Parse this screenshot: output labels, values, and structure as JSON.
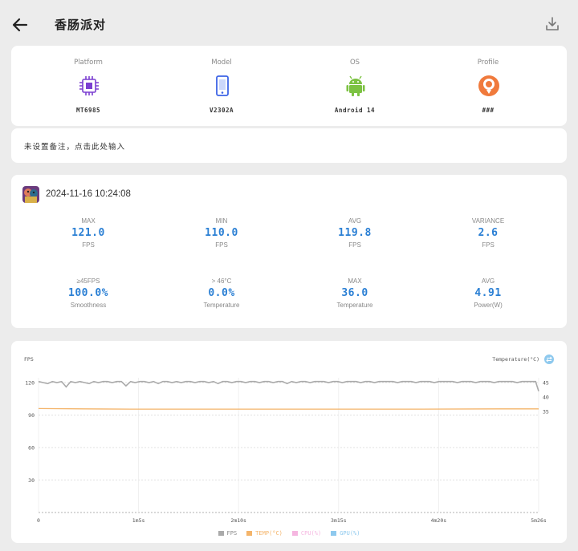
{
  "header": {
    "title": "香肠派对"
  },
  "device": {
    "items": [
      {
        "label": "Platform",
        "value": "MT6985",
        "icon": "chip-icon"
      },
      {
        "label": "Model",
        "value": "V2302A",
        "icon": "phone-icon"
      },
      {
        "label": "OS",
        "value": "Android 14",
        "icon": "android-icon"
      },
      {
        "label": "Profile",
        "value": "###",
        "icon": "profile-icon"
      }
    ]
  },
  "note": {
    "text": "未设置备注，点击此处输入"
  },
  "session": {
    "datetime": "2024-11-16 10:24:08",
    "stats": [
      {
        "label": "MAX",
        "value": "121.0",
        "unit": "FPS"
      },
      {
        "label": "MIN",
        "value": "110.0",
        "unit": "FPS"
      },
      {
        "label": "AVG",
        "value": "119.8",
        "unit": "FPS"
      },
      {
        "label": "VARIANCE",
        "value": "2.6",
        "unit": "FPS"
      },
      {
        "label": "≥45FPS",
        "value": "100.0%",
        "unit": "Smoothness"
      },
      {
        "label": "> 46°C",
        "value": "0.0%",
        "unit": "Temperature"
      },
      {
        "label": "MAX",
        "value": "36.0",
        "unit": "Temperature"
      },
      {
        "label": "AVG",
        "value": "4.91",
        "unit": "Power(W)"
      }
    ]
  },
  "chart_labels": {
    "left_axis_title": "FPS",
    "right_axis_title": "Temperature(°C)"
  },
  "chart_data": {
    "type": "line",
    "x_tick_labels": [
      "0",
      "1m5s",
      "2m10s",
      "3m15s",
      "4m20s",
      "5m26s"
    ],
    "x_duration_seconds": 326,
    "y_left_ticks": [
      120,
      90,
      60,
      30
    ],
    "y_left_range": [
      0,
      120
    ],
    "y_right_ticks": [
      45,
      40,
      35
    ],
    "legend": [
      "FPS",
      "TEMP(°C)",
      "CPU(%)",
      "GPU(%)"
    ],
    "series": [
      {
        "name": "FPS",
        "color": "#aaaaaa",
        "x": [
          0,
          3,
          6,
          9,
          12,
          15,
          18,
          21,
          24,
          27,
          30,
          33,
          36,
          39,
          42,
          45,
          48,
          51,
          54,
          57,
          60,
          63,
          66,
          69,
          72,
          75,
          78,
          81,
          84,
          87,
          90,
          93,
          96,
          99,
          102,
          105,
          108,
          111,
          114,
          117,
          120,
          123,
          126,
          129,
          132,
          135,
          138,
          141,
          144,
          147,
          150,
          153,
          156,
          159,
          162,
          165,
          168,
          171,
          174,
          177,
          180,
          183,
          186,
          189,
          192,
          195,
          198,
          201,
          204,
          207,
          210,
          213,
          216,
          219,
          222,
          225,
          228,
          231,
          234,
          237,
          240,
          243,
          246,
          249,
          252,
          255,
          258,
          261,
          264,
          267,
          270,
          273,
          276,
          279,
          282,
          285,
          288,
          291,
          294,
          297,
          300,
          303,
          306,
          309,
          312,
          315,
          318,
          321,
          324,
          326
        ],
        "values": [
          121,
          120,
          119,
          121,
          120,
          121,
          116,
          121,
          120,
          121,
          120,
          119,
          121,
          120,
          121,
          121,
          120,
          121,
          121,
          117,
          121,
          120,
          121,
          121,
          120,
          121,
          119,
          121,
          121,
          120,
          121,
          120,
          121,
          121,
          120,
          121,
          121,
          120,
          121,
          119,
          121,
          121,
          120,
          121,
          121,
          120,
          121,
          121,
          120,
          121,
          121,
          120,
          121,
          121,
          119,
          121,
          120,
          121,
          121,
          120,
          121,
          121,
          121,
          120,
          121,
          121,
          120,
          121,
          121,
          121,
          120,
          121,
          121,
          120,
          121,
          121,
          121,
          121,
          120,
          121,
          121,
          121,
          120,
          121,
          121,
          121,
          120,
          121,
          121,
          121,
          121,
          120,
          121,
          121,
          121,
          120,
          121,
          121,
          121,
          120,
          121,
          121,
          121,
          121,
          120,
          121,
          121,
          121,
          121,
          112
        ]
      },
      {
        "name": "TEMP(°C)",
        "color": "#f4b46a",
        "x": [
          0,
          30,
          60,
          100,
          150,
          200,
          250,
          300,
          326
        ],
        "values": [
          36,
          35.9,
          35.8,
          35.8,
          35.8,
          35.8,
          35.8,
          35.9,
          35.9
        ]
      },
      {
        "name": "CPU(%)",
        "color": "#f5b6e0",
        "x": [],
        "values": []
      },
      {
        "name": "GPU(%)",
        "color": "#8ec9ee",
        "x": [],
        "values": []
      }
    ]
  }
}
